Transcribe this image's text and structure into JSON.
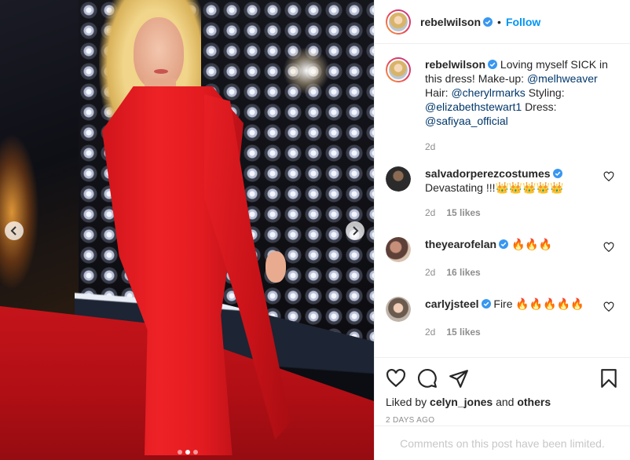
{
  "post": {
    "username": "rebelwilson",
    "follow_label": "Follow",
    "separator": "•",
    "caption_text": "Loving myself SICK in this dress! Make-up:",
    "mention_makeup": "@melhweaver",
    "hair_label": "Hair:",
    "mention_hair": "@cherylrmarks",
    "styling_label": "Styling:",
    "mention_styling": "@elizabethstewart1",
    "dress_label": "Dress:",
    "mention_dress": "@safiyaa_official",
    "caption_time": "2d",
    "liked_by_prefix": "Liked by",
    "liked_by_user": "celyn_jones",
    "liked_by_and": "and",
    "liked_by_others": "others",
    "posted_ago": "2 DAYS AGO",
    "comments_limited": "Comments on this post have been limited."
  },
  "comments": [
    {
      "username": "salvadorperezcostumes",
      "text": "Devastating !!!👑👑👑👑👑",
      "time": "2d",
      "likes": "15 likes",
      "avatar_icon": "avatar-salvador"
    },
    {
      "username": "theyearofelan",
      "text": "🔥🔥🔥",
      "time": "2d",
      "likes": "16 likes",
      "avatar_icon": "avatar-theyearofelan"
    },
    {
      "username": "carlyjsteel",
      "text": "Fire 🔥🔥🔥🔥🔥",
      "time": "2d",
      "likes": "15 likes",
      "avatar_icon": "avatar-carlyjsteel"
    }
  ],
  "carousel": {
    "total": 3,
    "active": 2
  },
  "colors": {
    "accent": "#0095f6",
    "verified": "#3897f0",
    "mention": "#00376b",
    "muted": "#8e8e8e"
  },
  "icons": [
    "verified-badge-icon",
    "heart-icon",
    "comment-icon",
    "share-icon",
    "bookmark-icon",
    "chevron-left-icon",
    "chevron-right-icon"
  ]
}
